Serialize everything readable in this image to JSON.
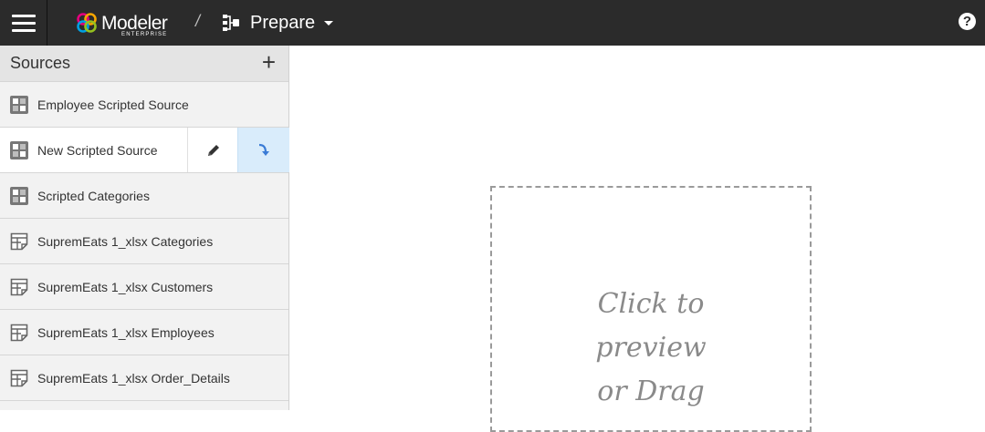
{
  "app": {
    "logo_text": "Modeler",
    "logo_subtext": "ENTERPRISE",
    "breadcrumb_separator": "/",
    "section_label": "Prepare",
    "help_symbol": "?"
  },
  "icons": {
    "menu": "hamburger-menu-icon",
    "logo": "modeler-logo-icon",
    "section": "prepare-flow-icon",
    "help": "help-circle-icon",
    "add": "plus-icon",
    "scripted_source": "scripted-source-icon",
    "table_source": "table-source-icon",
    "edit": "pencil-icon",
    "preview": "curved-arrow-icon"
  },
  "sidebar": {
    "title": "Sources",
    "add_label": "+",
    "items": [
      {
        "label": "Employee Scripted Source",
        "type": "scripted"
      },
      {
        "label": "New Scripted Source",
        "type": "scripted",
        "active": true
      },
      {
        "label": "Scripted Categories",
        "type": "scripted"
      },
      {
        "label": "SupremEats 1_xlsx Categories",
        "type": "table"
      },
      {
        "label": "SupremEats 1_xlsx Customers",
        "type": "table"
      },
      {
        "label": "SupremEats 1_xlsx Employees",
        "type": "table"
      },
      {
        "label": "SupremEats 1_xlsx Order_Details",
        "type": "table"
      }
    ]
  },
  "main": {
    "drop_text": "Click to\npreview\nor Drag"
  },
  "colors": {
    "topbar": "#2b2b2b",
    "sidebar": "#f2f2f2",
    "active_action": "#d9ecfb",
    "accent_blue": "#3a7bd5"
  }
}
